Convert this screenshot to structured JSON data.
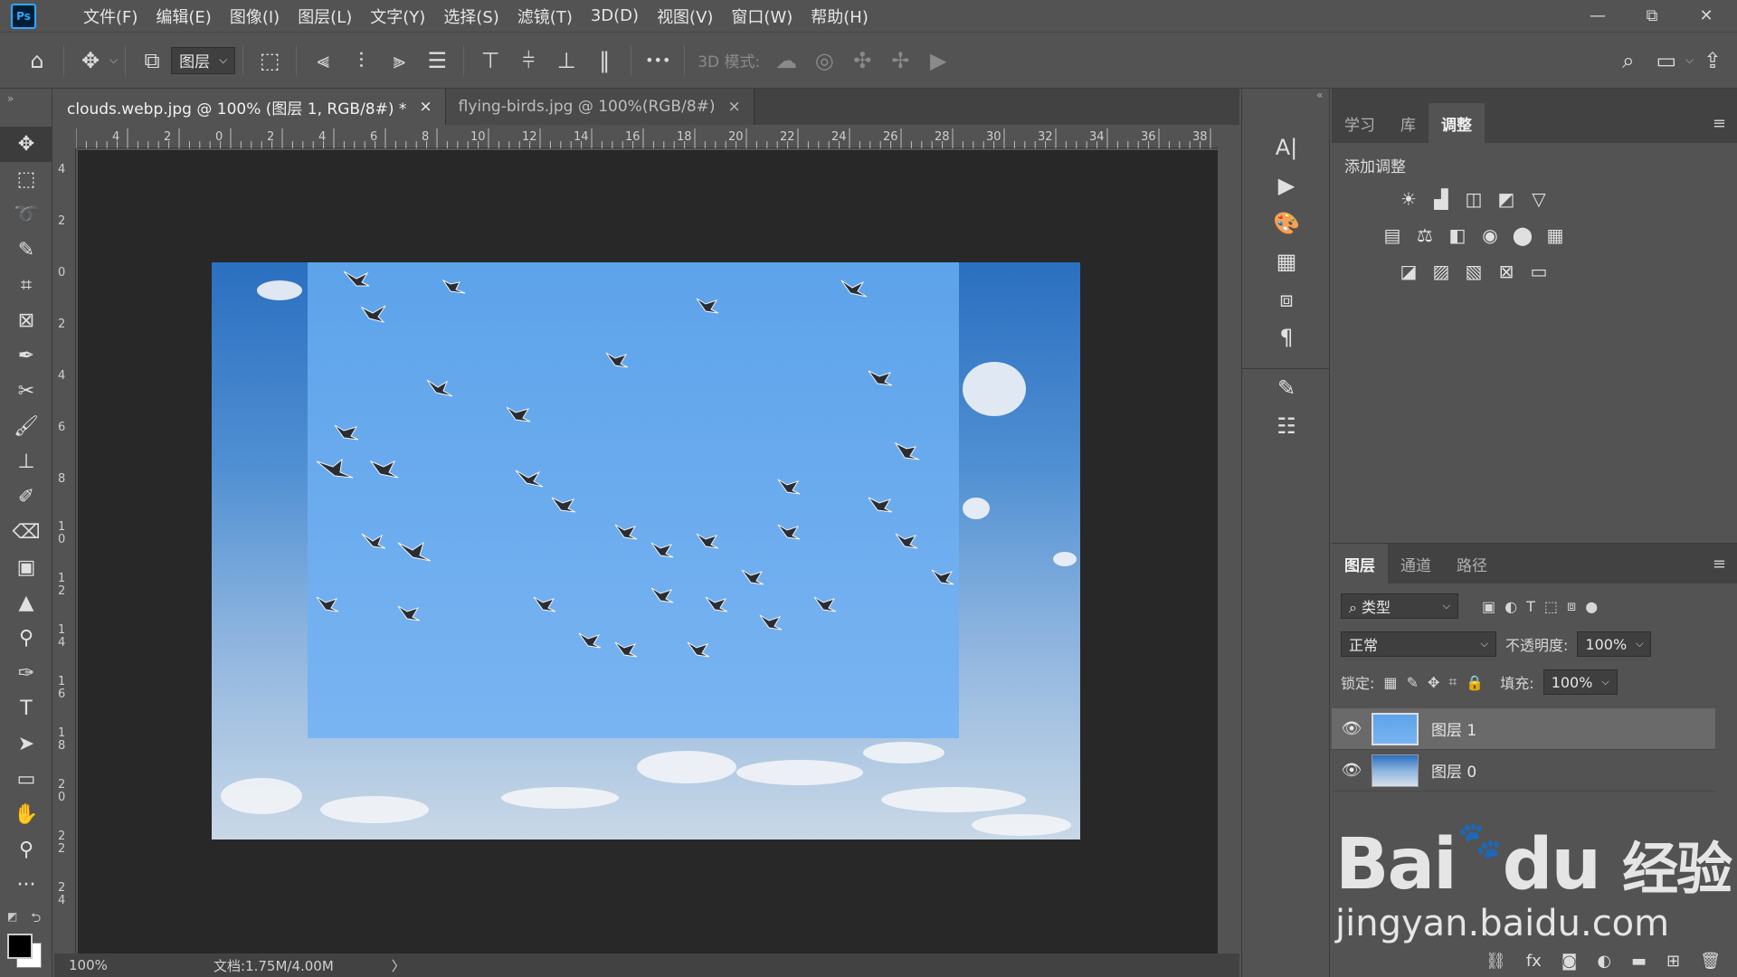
{
  "app": {
    "logo": "Ps"
  },
  "menu": [
    "文件(F)",
    "编辑(E)",
    "图像(I)",
    "图层(L)",
    "文字(Y)",
    "选择(S)",
    "滤镜(T)",
    "3D(D)",
    "视图(V)",
    "窗口(W)",
    "帮助(H)"
  ],
  "window_controls": {
    "minimize": "—",
    "restore": "⧉",
    "close": "✕"
  },
  "options_bar": {
    "auto_select_target": "图层",
    "mode_3d_label": "3D 模式:",
    "more": "•••"
  },
  "tabs": [
    {
      "label": "clouds.webp.jpg @ 100% (图层 1, RGB/8#) *",
      "close": "×",
      "active": true
    },
    {
      "label": "flying-birds.jpg @ 100%(RGB/8#)",
      "close": "×",
      "active": false
    }
  ],
  "ruler_h": [
    "4",
    "2",
    "0",
    "2",
    "4",
    "6",
    "8",
    "10",
    "12",
    "14",
    "16",
    "18",
    "20",
    "22",
    "24",
    "26",
    "28",
    "30",
    "32",
    "34",
    "36",
    "38"
  ],
  "ruler_v": [
    "4",
    "2",
    "0",
    "2",
    "4",
    "6",
    "8",
    "1 0",
    "1 2",
    "1 4",
    "1 6",
    "1 8",
    "2 0",
    "2 2",
    "2 4"
  ],
  "status": {
    "zoom": "100%",
    "doc": "文档:1.75M/4.00M",
    "arrow": "〉"
  },
  "adjust_panel": {
    "tabs": [
      "学习",
      "库",
      "调整"
    ],
    "active_tab": "调整",
    "title": "添加调整"
  },
  "layers_panel": {
    "tabs": [
      "图层",
      "通道",
      "路径"
    ],
    "filter_label": "类型",
    "blend_mode": "正常",
    "opacity_label": "不透明度:",
    "opacity_value": "100%",
    "lock_label": "锁定:",
    "fill_label": "填充:",
    "fill_value": "100%",
    "layers": [
      {
        "name": "图层 1",
        "selected": true
      },
      {
        "name": "图层 0",
        "selected": false
      }
    ]
  },
  "watermark": {
    "brand": "Bai",
    "brand2": "du",
    "cn": "经验",
    "url": "jingyan.baidu.com"
  }
}
